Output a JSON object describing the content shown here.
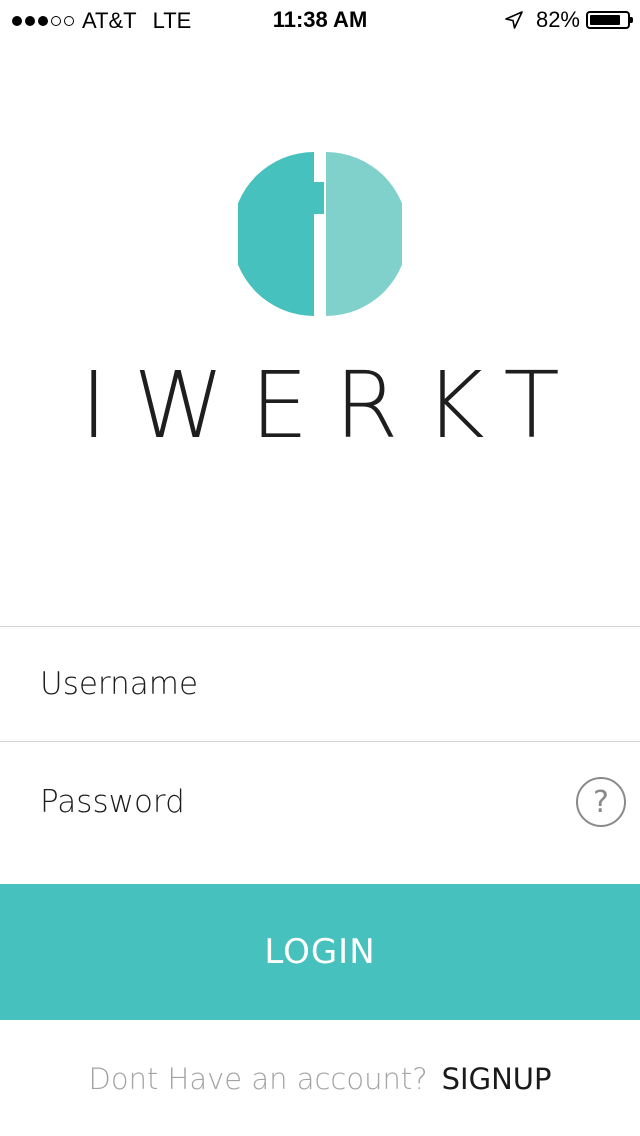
{
  "status_bar": {
    "signal_filled": 3,
    "signal_total": 5,
    "carrier": "AT&T",
    "network": "LTE",
    "time": "11:38 AM",
    "battery_percent_label": "82%",
    "battery_level": 0.82
  },
  "brand": {
    "name": "IWERKT",
    "logo_colors": {
      "left": "#46c1be",
      "right": "#80d0cb"
    }
  },
  "form": {
    "username_placeholder": "Username",
    "password_placeholder": "Password",
    "help_icon_glyph": "?"
  },
  "login_button": {
    "label": "LOGIN",
    "color": "#46c1be"
  },
  "signup": {
    "prompt": "Dont Have an account?",
    "link": "SIGNUP"
  }
}
